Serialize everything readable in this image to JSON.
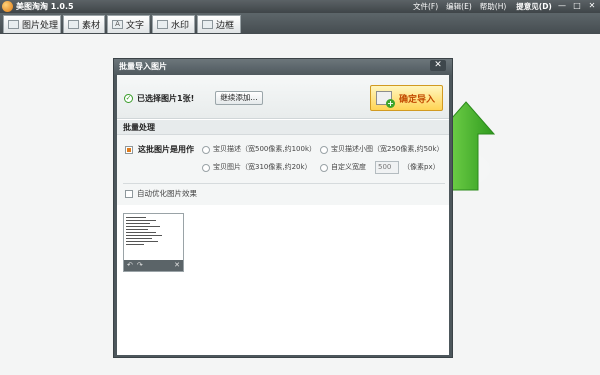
{
  "app": {
    "title": "美图淘淘 1.0.5"
  },
  "menu": {
    "file": "文件(F)",
    "edit": "编辑(E)",
    "help": "帮助(H)",
    "feedback": "提意见(D)"
  },
  "window_controls": {
    "minimize": "—",
    "restore": "□",
    "close": "✕"
  },
  "tabs": [
    {
      "label": "图片处理",
      "icon": "image-icon"
    },
    {
      "label": "素材",
      "icon": "material-icon"
    },
    {
      "label": "文字",
      "icon": "text-icon",
      "icon_glyph": "A"
    },
    {
      "label": "水印",
      "icon": "watermark-icon"
    },
    {
      "label": "边框",
      "icon": "border-icon"
    }
  ],
  "dialog": {
    "title": "批量导入图片",
    "close": "✕",
    "selected_text": "已选择图片1张!",
    "continue_label": "继续添加...",
    "confirm_label": "确定导入",
    "section_title": "批量处理",
    "use_as_label": "这批图片是用作",
    "options": {
      "desc": "宝贝描述（宽500像素,约100k）",
      "desc_small": "宝贝描述小图（宽250像素,约50k）",
      "pic": "宝贝图片（宽310像素,约20k）",
      "custom": "自定义宽度",
      "custom_value": "500",
      "unit": "（像素px）"
    },
    "auto_optimize_label": "自动优化图片效果"
  },
  "thumbnail": {
    "toolbar": {
      "rotate_left": "↶",
      "rotate_right": "↷",
      "delete": "✕"
    }
  },
  "colors": {
    "titlebar": "#4a5256",
    "confirm_button": "#ffd455",
    "arrow": "#3fb52e"
  }
}
